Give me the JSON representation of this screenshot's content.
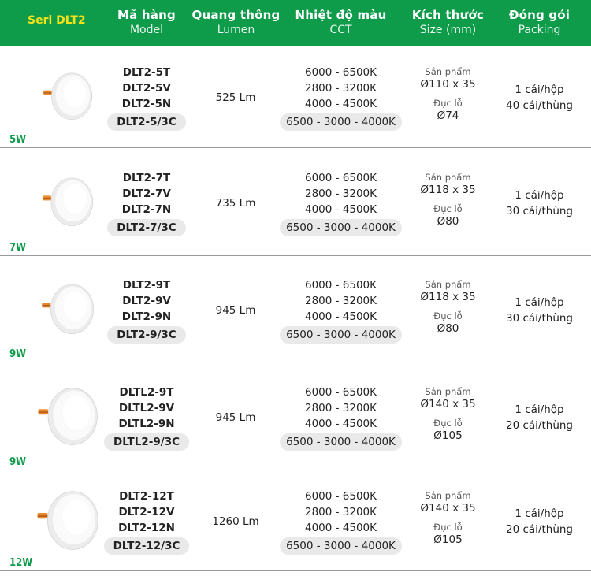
{
  "header": {
    "series": "Seri DLT2",
    "columns": [
      {
        "title": "Mã hàng",
        "sub": "Model"
      },
      {
        "title": "Quang thông",
        "sub": "Lumen"
      },
      {
        "title": "Nhiệt độ màu",
        "sub": "CCT"
      },
      {
        "title": "Kích thước",
        "sub": "Size (mm)"
      },
      {
        "title": "Đóng gói",
        "sub": "Packing"
      }
    ]
  },
  "rows": [
    {
      "watt": "5W",
      "models": [
        "DLT2-5T",
        "DLT2-5V",
        "DLT2-5N"
      ],
      "combo": "DLT2-5/3C",
      "lumen": "525 Lm",
      "cct": [
        "6000 - 6500K",
        "2800 - 3200K",
        "4000 - 4500K"
      ],
      "cct_combo": "6500 - 3000 - 4000K",
      "size_label": "Sản phẩm",
      "size": "Ø110 x 35",
      "cut_label": "Đục lỗ",
      "cut": "Ø74",
      "pack1": "1 cái/hộp",
      "pack2": "40 cái/thùng"
    },
    {
      "watt": "7W",
      "models": [
        "DLT2-7T",
        "DLT2-7V",
        "DLT2-7N"
      ],
      "combo": "DLT2-7/3C",
      "lumen": "735 Lm",
      "cct": [
        "6000 - 6500K",
        "2800 - 3200K",
        "4000 - 4500K"
      ],
      "cct_combo": "6500 - 3000 - 4000K",
      "size_label": "Sản phẩm",
      "size": "Ø118 x 35",
      "cut_label": "Đục lỗ",
      "cut": "Ø80",
      "pack1": "1 cái/hộp",
      "pack2": "30 cái/thùng"
    },
    {
      "watt": "9W",
      "models": [
        "DLT2-9T",
        "DLT2-9V",
        "DLT2-9N"
      ],
      "combo": "DLT2-9/3C",
      "lumen": "945 Lm",
      "cct": [
        "6000 - 6500K",
        "2800 - 3200K",
        "4000 - 4500K"
      ],
      "cct_combo": "6500 - 3000 - 4000K",
      "size_label": "Sản phẩm",
      "size": "Ø118 x 35",
      "cut_label": "Đục lỗ",
      "cut": "Ø80",
      "pack1": "1 cái/hộp",
      "pack2": "30 cái/thùng"
    },
    {
      "watt": "9W",
      "models": [
        "DLTL2-9T",
        "DLTL2-9V",
        "DLTL2-9N"
      ],
      "combo": "DLTL2-9/3C",
      "lumen": "945 Lm",
      "cct": [
        "6000 - 6500K",
        "2800 - 3200K",
        "4000 - 4500K"
      ],
      "cct_combo": "6500 - 3000 - 4000K",
      "size_label": "Sản phẩm",
      "size": "Ø140 x 35",
      "cut_label": "Đục lỗ",
      "cut": "Ø105",
      "pack1": "1 cái/hộp",
      "pack2": "20 cái/thùng"
    },
    {
      "watt": "12W",
      "models": [
        "DLT2-12T",
        "DLT2-12V",
        "DLT2-12N"
      ],
      "combo": "DLT2-12/3C",
      "lumen": "1260 Lm",
      "cct": [
        "6000 - 6500K",
        "2800 - 3200K",
        "4000 - 4500K"
      ],
      "cct_combo": "6500 - 3000 - 4000K",
      "size_label": "Sản phẩm",
      "size": "Ø140 x 35",
      "cut_label": "Đục lỗ",
      "cut": "Ø105",
      "pack1": "1 cái/hộp",
      "pack2": "20 cái/thùng"
    }
  ],
  "colors": {
    "header_bg": "#0e9b4a",
    "series_text": "#f2e21a",
    "watt_text": "#0e9b4a",
    "pill_bg": "#e9e9e9"
  },
  "icons": {
    "product": "round-downlight-icon"
  }
}
